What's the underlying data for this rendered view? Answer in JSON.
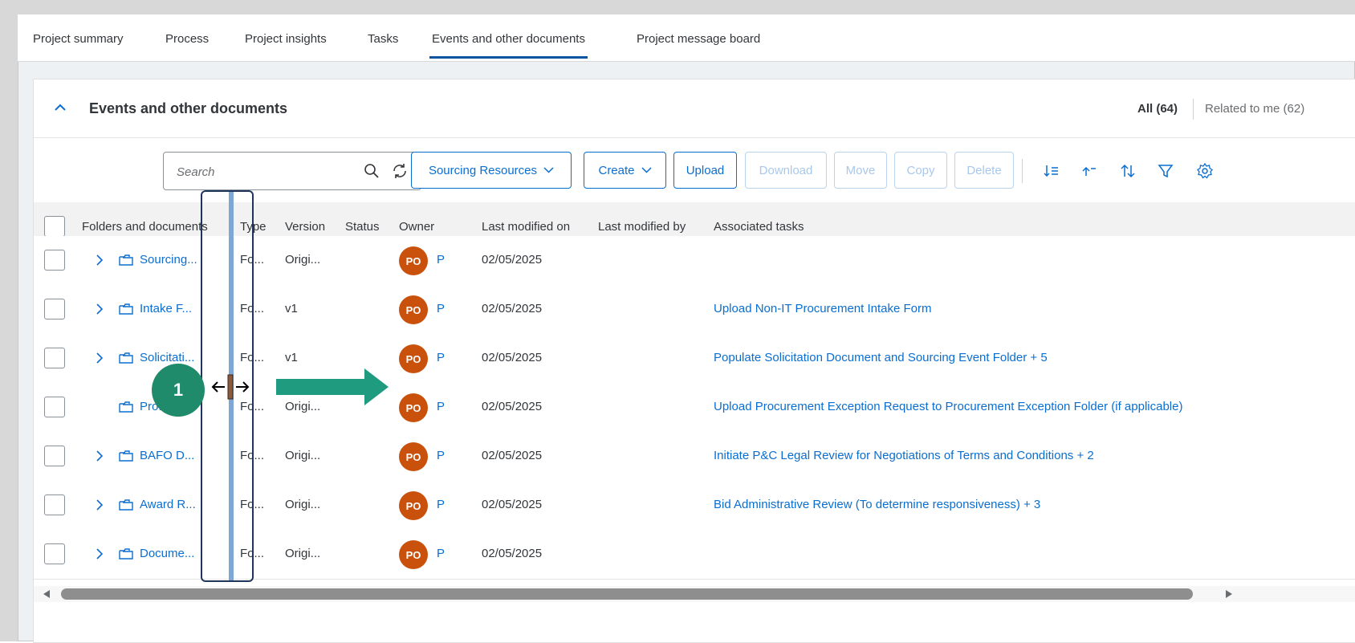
{
  "tabs": [
    {
      "label": "Project summary",
      "selected": false
    },
    {
      "label": "Process",
      "selected": false
    },
    {
      "label": "Project insights",
      "selected": false
    },
    {
      "label": "Tasks",
      "selected": false
    },
    {
      "label": "Events and other documents",
      "selected": true
    },
    {
      "label": "Project message board",
      "selected": false
    }
  ],
  "card": {
    "title": "Events and other documents",
    "filter_all": "All (64)",
    "filter_related": "Related to me (62)"
  },
  "toolbar": {
    "search_placeholder": "Search",
    "sourcing_resources": "Sourcing Resources",
    "create": "Create",
    "upload": "Upload",
    "download": "Download",
    "move": "Move",
    "copy": "Copy",
    "delete": "Delete"
  },
  "columns": [
    "Folders and documents",
    "Type",
    "Version",
    "Status",
    "Owner",
    "Last modified on",
    "Last modified by",
    "Associated tasks"
  ],
  "rows": [
    {
      "name": "Sourcing...",
      "type": "Fo...",
      "version": "Origi...",
      "owner_initials": "PO",
      "owner": "P",
      "modified_on": "02/05/2025",
      "tasks": "",
      "expandable": true
    },
    {
      "name": "Intake F...",
      "type": "Fo...",
      "version": "v1",
      "owner_initials": "PO",
      "owner": "P",
      "modified_on": "02/05/2025",
      "tasks": "Upload Non-IT Procurement Intake Form",
      "expandable": true
    },
    {
      "name": "Solicitati...",
      "type": "Fo...",
      "version": "v1",
      "owner_initials": "PO",
      "owner": "P",
      "modified_on": "02/05/2025",
      "tasks": "Populate Solicitation Document and Sourcing Event Folder + 5",
      "expandable": true
    },
    {
      "name": "Pro...",
      "type": "Fo...",
      "version": "Origi...",
      "owner_initials": "PO",
      "owner": "P",
      "modified_on": "02/05/2025",
      "tasks": "Upload Procurement Exception Request to Procurement Exception Folder (if applicable)",
      "expandable": false
    },
    {
      "name": "BAFO D...",
      "type": "Fo...",
      "version": "Origi...",
      "owner_initials": "PO",
      "owner": "P",
      "modified_on": "02/05/2025",
      "tasks": "Initiate P&C Legal Review for Negotiations of Terms and Conditions + 2",
      "expandable": true
    },
    {
      "name": "Award R...",
      "type": "Fo...",
      "version": "Origi...",
      "owner_initials": "PO",
      "owner": "P",
      "modified_on": "02/05/2025",
      "tasks": "Bid Administrative Review (To determine responsiveness) + 3",
      "expandable": true
    },
    {
      "name": "Docume...",
      "type": "Fo...",
      "version": "Origi...",
      "owner_initials": "PO",
      "owner": "P",
      "modified_on": "02/05/2025",
      "tasks": "",
      "expandable": true
    }
  ],
  "annotation": {
    "step": "1"
  },
  "colors": {
    "accent": "#0a6ed1",
    "avatar": "#c9510c",
    "step_badge": "#1f8b6b",
    "tab_underline": "#0854a0"
  }
}
